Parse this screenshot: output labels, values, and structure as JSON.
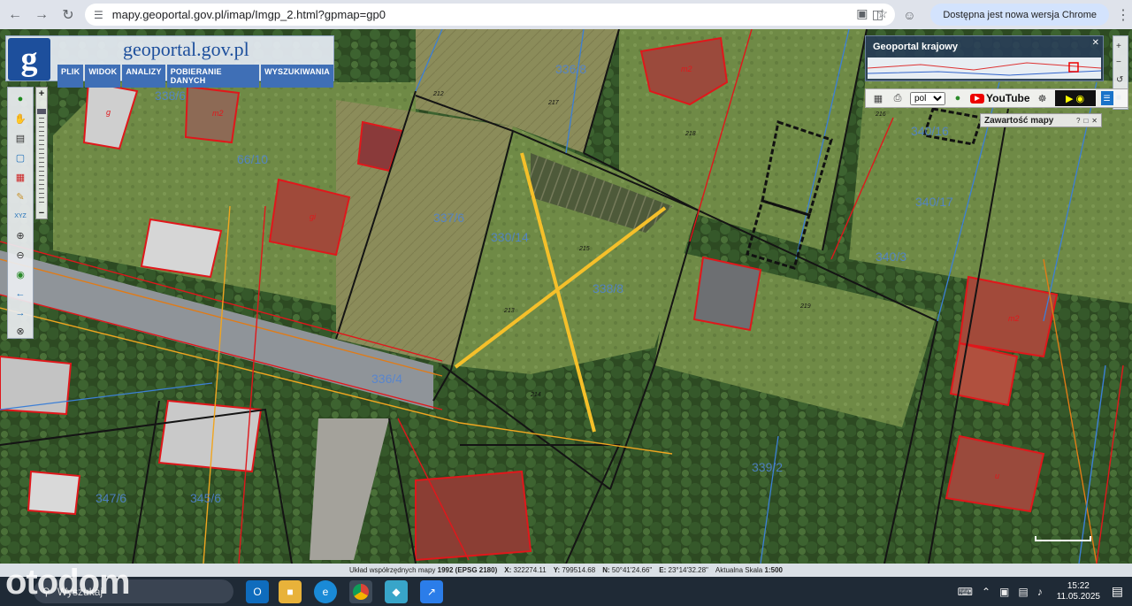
{
  "browser": {
    "url": "mapy.geoportal.gov.pl/imap/Imgp_2.html?gpmap=gp0",
    "update_label": "Dostępna jest nowa wersja Chrome"
  },
  "geoportal": {
    "title": "geoportal.gov.pl",
    "logo_letter": "g",
    "menu": [
      "PLIK",
      "WIDOK",
      "ANALIZY",
      "POBIERANIE DANYCH",
      "WYSZUKIWANIA"
    ]
  },
  "right_panel": {
    "title": "Geoportal krajowy",
    "language": "pol",
    "youtube_label": "YouTube",
    "content_title": "Zawartość mapy"
  },
  "parcels": {
    "labels": [
      "66/10",
      "338/6",
      "339/2",
      "340/16",
      "340/17",
      "347/6",
      "345/6",
      "336/4",
      "337/6",
      "336/8",
      "338/8",
      "330/14",
      "340/3"
    ],
    "elevations": [
      "213",
      "215",
      "214",
      "219",
      "217",
      "218",
      "216",
      "212"
    ],
    "building_codes": [
      "m2",
      "gi",
      "g",
      "m2",
      "m2",
      "u"
    ]
  },
  "status": {
    "system_label": "Układ współrzędnych mapy",
    "system_value": "1992 (EPSG 2180)",
    "x_label": "X:",
    "x_value": "322274.11",
    "y_label": "Y:",
    "y_value": "799514.68",
    "n_label": "N:",
    "n_value": "50°41'24.66\"",
    "e_label": "E:",
    "e_value": "23°14'32.28\"",
    "scale_label": "Aktualna Skala",
    "scale_value": "1:500"
  },
  "taskbar": {
    "search_placeholder": "Wyszukaj",
    "time": "15:22",
    "date": "11.05.2025"
  },
  "watermark": "otodom",
  "colors": {
    "marker": "#f5c02a",
    "parcel_line": "#1a1a1a",
    "building_line": "#e0171b",
    "boundary_blue": "#3c7fd6"
  }
}
